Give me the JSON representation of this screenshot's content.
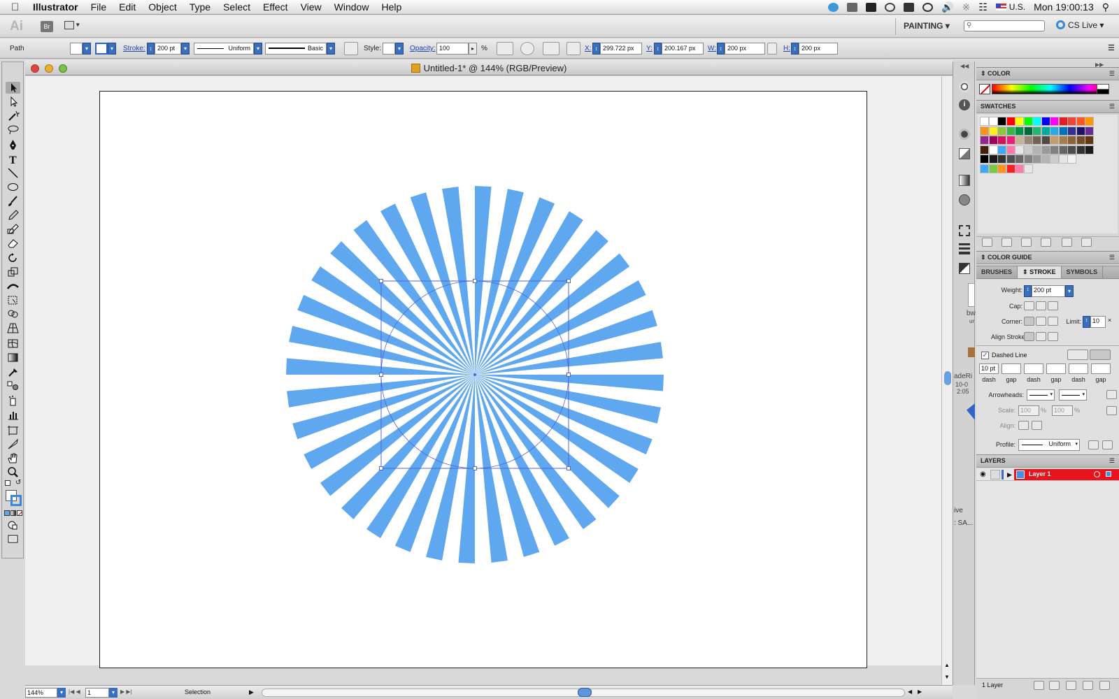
{
  "menubar": {
    "app_name": "Illustrator",
    "items": [
      "File",
      "Edit",
      "Object",
      "Type",
      "Select",
      "Effect",
      "View",
      "Window",
      "Help"
    ],
    "input_source": "U.S.",
    "clock": "Mon 19:00:13"
  },
  "appbar": {
    "logo": "Ai",
    "bridge": "Br",
    "workspace": "PAINTING",
    "cs_live": "CS Live"
  },
  "control_bar": {
    "selection_type": "Path",
    "stroke_label": "Stroke:",
    "stroke_weight": "200 pt",
    "profile": "Uniform",
    "brush": "Basic",
    "style_label": "Style:",
    "opacity_label": "Opacity:",
    "opacity_value": "100",
    "opacity_unit": "%",
    "x_label": "X:",
    "x_value": "299.722 px",
    "y_label": "Y:",
    "y_value": "200.167 px",
    "w_label": "W:",
    "w_value": "200 px",
    "h_label": "H:",
    "h_value": "200 px"
  },
  "document": {
    "title": "Untitled-1* @ 144% (RGB/Preview)",
    "ray_count": 36,
    "ray_color": "#5fa8f0",
    "selection_color": "#4f63d6"
  },
  "status_bar": {
    "zoom": "144%",
    "page": "1",
    "tool": "Selection"
  },
  "panels": {
    "color": {
      "title": "COLOR"
    },
    "swatches": {
      "title": "SWATCHES"
    },
    "color_guide": {
      "title": "COLOR GUIDE"
    },
    "tabs": [
      {
        "label": "BRUSHES",
        "active": false
      },
      {
        "label": "STROKE",
        "active": true
      },
      {
        "label": "SYMBOLS",
        "active": false
      }
    ],
    "stroke": {
      "weight_label": "Weight:",
      "weight_value": "200 pt",
      "cap_label": "Cap:",
      "corner_label": "Corner:",
      "limit_label": "Limit:",
      "limit_value": "10",
      "align_label": "Align Stroke:",
      "dashed_label": "Dashed Line",
      "dashed_checked": true,
      "dash_values": [
        "10 pt",
        "",
        "",
        "",
        "",
        ""
      ],
      "dash_labels": [
        "dash",
        "gap",
        "dash",
        "gap",
        "dash",
        "gap"
      ],
      "arrowheads_label": "Arrowheads:",
      "scale_label": "Scale:",
      "scale_values": [
        "100",
        "100"
      ],
      "scale_unit": "%",
      "align_arrow_label": "Align:",
      "profile_label": "Profile:",
      "profile_value": "Uniform"
    },
    "layers": {
      "title": "LAYERS",
      "rows": [
        {
          "name": "Layer 1",
          "color": "#e8141b"
        }
      ],
      "footer": "1 Layer"
    }
  },
  "behind_window_text": [
    "bw",
    "ur",
    "adeRi",
    "10-0",
    "2:05",
    "ive",
    ": SA..."
  ]
}
